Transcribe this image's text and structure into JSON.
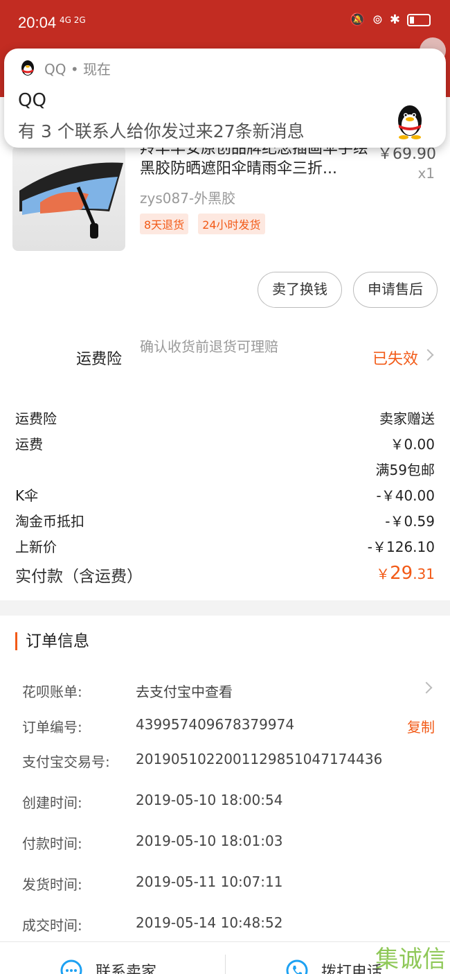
{
  "status_bar": {
    "time": "20:04",
    "network": "4G 2G"
  },
  "notification": {
    "app": "QQ • 现在",
    "title": "QQ",
    "message": "有 3 个联系人给你发过来27条新消息"
  },
  "product": {
    "title": "羚羊早安原创品牌纪念插画伞手绘黑胶防晒遮阳伞晴雨伞三折...",
    "price": "￥69.90",
    "qty": "x1",
    "spec": "zys087-外黑胶",
    "tags": [
      "8天退货",
      "24小时发货"
    ]
  },
  "actions": {
    "sell": "卖了换钱",
    "after_sale": "申请售后"
  },
  "insurance": {
    "label": "运费险",
    "desc": "确认收货前退货可理赔",
    "status": "已失效"
  },
  "fees": [
    {
      "k": "运费险",
      "v": "卖家赠送"
    },
    {
      "k": "运费",
      "v": "￥0.00"
    },
    {
      "k": "",
      "v": "满59包邮"
    },
    {
      "k": "K伞",
      "v": "-￥40.00"
    },
    {
      "k": "淘金币抵扣",
      "v": "-￥0.59"
    },
    {
      "k": "上新价",
      "v": "-￥126.10"
    }
  ],
  "total": {
    "label": "实付款（含运费）",
    "currency": "￥",
    "int": "29",
    "dec": ".31"
  },
  "order_info": {
    "title": "订单信息",
    "rows": [
      {
        "k": "花呗账单:",
        "v": "去支付宝中查看"
      },
      {
        "k": "订单编号:",
        "v": "439957409678379974",
        "action": "复制"
      },
      {
        "k": "支付宝交易号:",
        "v": "2019051022001129851047174436"
      },
      {
        "k": "创建时间:",
        "v": "2019-05-10 18:00:54"
      },
      {
        "k": "付款时间:",
        "v": "2019-05-10 18:01:03"
      },
      {
        "k": "发货时间:",
        "v": "2019-05-11 10:07:11"
      },
      {
        "k": "成交时间:",
        "v": "2019-05-14 10:48:52"
      }
    ]
  },
  "bottom": {
    "contact_seller": "联系卖家",
    "call": "拨打电话"
  },
  "watermark": "集诚信",
  "colors": {
    "header": "#c22c22",
    "accent": "#f25a17"
  },
  "icons": [
    "qq-penguin-icon",
    "chevron-right-icon",
    "chat-icon",
    "phone-icon",
    "battery-icon",
    "bluetooth-icon",
    "mute-icon"
  ]
}
